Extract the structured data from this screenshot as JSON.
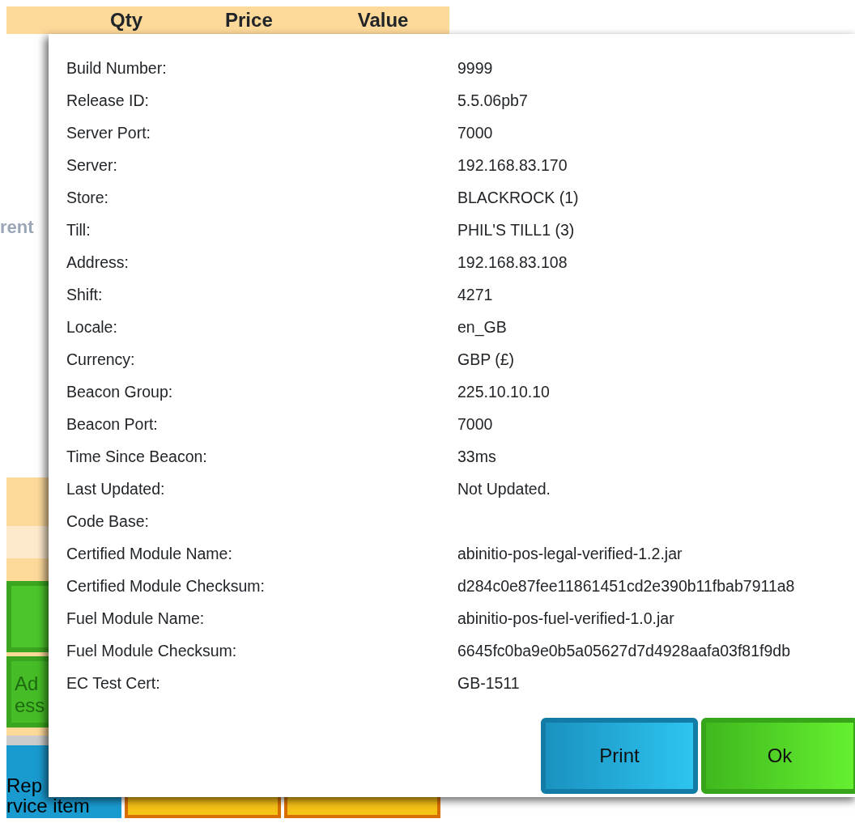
{
  "background": {
    "columns": [
      "Qty",
      "Price",
      "Value"
    ],
    "side_label": "rent",
    "green_buttons": [
      {
        "kind": "green"
      },
      {
        "kind": "green",
        "lines": [
          "Ad",
          "ess"
        ],
        "disabled": true
      }
    ],
    "bottom_buttons": [
      {
        "lines": [
          "Rep",
          "rvice item"
        ],
        "kind": "blue"
      },
      {
        "kind": "orange"
      },
      {
        "kind": "orange"
      }
    ]
  },
  "dialog": {
    "rows": [
      {
        "label": "Build Number:",
        "value": "9999"
      },
      {
        "label": "Release ID:",
        "value": "5.5.06pb7"
      },
      {
        "label": "Server Port:",
        "value": "7000"
      },
      {
        "label": "Server:",
        "value": "192.168.83.170"
      },
      {
        "label": "Store:",
        "value": "BLACKROCK (1)"
      },
      {
        "label": "Till:",
        "value": "PHIL'S TILL1 (3)"
      },
      {
        "label": "Address:",
        "value": "192.168.83.108"
      },
      {
        "label": "Shift:",
        "value": "4271"
      },
      {
        "label": "Locale:",
        "value": "en_GB"
      },
      {
        "label": "Currency:",
        "value": "GBP (£)"
      },
      {
        "label": "Beacon Group:",
        "value": "225.10.10.10"
      },
      {
        "label": "Beacon Port:",
        "value": "7000"
      },
      {
        "label": "Time Since Beacon:",
        "value": "33ms"
      },
      {
        "label": "Last Updated:",
        "value": "Not Updated."
      },
      {
        "label": "Code Base:"
      },
      {
        "label": "Certified Module Name:",
        "value": "abinitio-pos-legal-verified-1.2.jar"
      },
      {
        "label": "Certified Module Checksum:",
        "value": "d284c0e87fee11861451cd2e390b11fbab7911a8"
      },
      {
        "label": "Fuel Module Name:",
        "value": "abinitio-pos-fuel-verified-1.0.jar"
      },
      {
        "label": "Fuel Module Checksum:",
        "value": "6645fc0ba9e0b5a05627d7d4928aafa03f81f9db"
      },
      {
        "label": "EC Test Cert:",
        "value": "GB-1511"
      }
    ],
    "buttons": [
      {
        "label": "Print",
        "kind": "blue"
      },
      {
        "label": "Ok",
        "kind": "green"
      }
    ]
  }
}
